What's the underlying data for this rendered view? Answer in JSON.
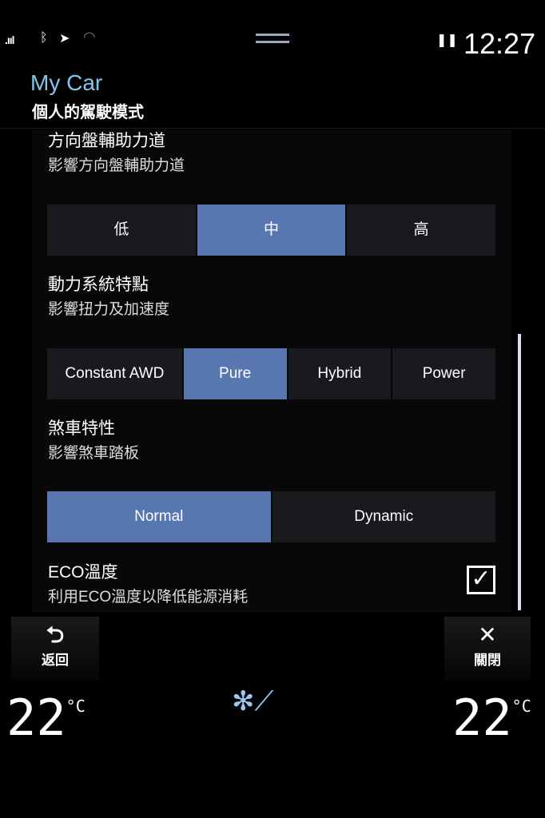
{
  "status": {
    "time": "12:27",
    "icons": [
      "signal-icon",
      "bluetooth-icon",
      "location-icon",
      "wifi-icon",
      "pause-icon"
    ]
  },
  "header": {
    "title": "My Car",
    "subtitle": "個人的駕駛模式"
  },
  "sections": [
    {
      "title": "方向盤輔助力道",
      "desc": "影響方向盤輔助力道",
      "options": [
        "低",
        "中",
        "高"
      ],
      "selected": "中"
    },
    {
      "title": "動力系統特點",
      "desc": "影響扭力及加速度",
      "options": [
        "Constant AWD",
        "Pure",
        "Hybrid",
        "Power"
      ],
      "selected": "Pure"
    },
    {
      "title": "煞車特性",
      "desc": "影響煞車踏板",
      "options": [
        "Normal",
        "Dynamic"
      ],
      "selected": "Normal"
    },
    {
      "title": "ECO溫度",
      "desc": "利用ECO溫度以降低能源消耗",
      "checked": true
    }
  ],
  "footer": {
    "back_label": "返回",
    "close_label": "關閉",
    "temp_left": "22",
    "temp_right": "22",
    "unit": "°C"
  },
  "colors": {
    "accent": "#5877b0",
    "title": "#7fc7ef"
  }
}
